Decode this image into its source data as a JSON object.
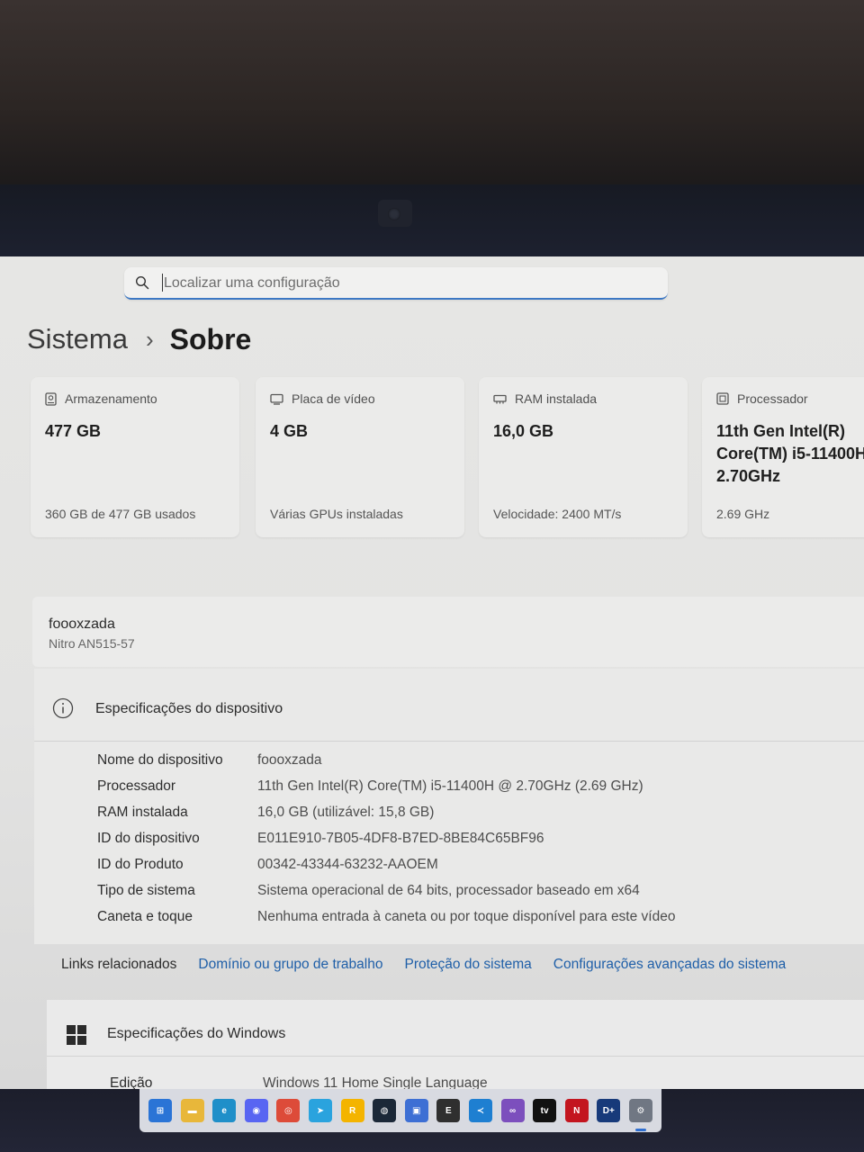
{
  "search": {
    "placeholder": "Localizar uma configuração"
  },
  "breadcrumb": {
    "parent": "Sistema",
    "current": "Sobre"
  },
  "cards": [
    {
      "title": "Armazenamento",
      "value": "477 GB",
      "sub": "360 GB de 477 GB usados",
      "icon": "storage-icon"
    },
    {
      "title": "Placa de vídeo",
      "value": "4 GB",
      "sub": "Várias GPUs instaladas",
      "icon": "gpu-icon"
    },
    {
      "title": "RAM instalada",
      "value": "16,0 GB",
      "sub": "Velocidade: 2400 MT/s",
      "icon": "ram-icon"
    },
    {
      "title": "Processador",
      "value_lines": [
        "11th Gen Intel(R)",
        "Core(TM) i5-11400H",
        "2.70GHz"
      ],
      "sub": "2.69 GHz",
      "icon": "processor-icon"
    }
  ],
  "device": {
    "name": "foooxzada",
    "model": "Nitro AN515-57"
  },
  "device_specs": {
    "title": "Especificações do dispositivo",
    "rows": [
      {
        "label": "Nome do dispositivo",
        "value": "foooxzada"
      },
      {
        "label": "Processador",
        "value": "11th Gen Intel(R) Core(TM) i5-11400H @ 2.70GHz (2.69 GHz)"
      },
      {
        "label": "RAM instalada",
        "value": "16,0 GB (utilizável: 15,8 GB)"
      },
      {
        "label": "ID do dispositivo",
        "value": "E011E910-7B05-4DF8-B7ED-8BE84C65BF96"
      },
      {
        "label": "ID do Produto",
        "value": "00342-43344-63232-AAOEM"
      },
      {
        "label": "Tipo de sistema",
        "value": "Sistema operacional de 64 bits, processador baseado em x64"
      },
      {
        "label": "Caneta e toque",
        "value": "Nenhuma entrada à caneta ou por toque disponível para este vídeo"
      }
    ]
  },
  "related_links": {
    "label": "Links relacionados",
    "links": [
      "Domínio ou grupo de trabalho",
      "Proteção do sistema",
      "Configurações avançadas do sistema"
    ]
  },
  "windows_specs": {
    "title": "Especificações do Windows",
    "rows": [
      {
        "label": "Edição",
        "value": "Windows 11 Home Single Language"
      }
    ]
  },
  "taskbar": {
    "items": [
      {
        "icon": "windows-start-icon",
        "color": "#2a74d6"
      },
      {
        "icon": "file-explorer-icon",
        "color": "#e8b73a"
      },
      {
        "icon": "edge-icon",
        "color": "#1f8fc9"
      },
      {
        "icon": "discord-icon",
        "color": "#5865f2"
      },
      {
        "icon": "chrome-icon",
        "color": "#dd4b39"
      },
      {
        "icon": "telegram-icon",
        "color": "#2aa3de"
      },
      {
        "icon": "rockstar-icon",
        "color": "#f4b400"
      },
      {
        "icon": "steam-icon",
        "color": "#1b2838"
      },
      {
        "icon": "store-icon",
        "color": "#3d6fd4"
      },
      {
        "icon": "epic-games-icon",
        "color": "#2f2f2f"
      },
      {
        "icon": "vscode-icon",
        "color": "#1e7fd1"
      },
      {
        "icon": "visual-studio-icon",
        "color": "#7c4fbd"
      },
      {
        "icon": "apple-tv-icon",
        "color": "#111111"
      },
      {
        "icon": "netflix-icon",
        "color": "#c3151f"
      },
      {
        "icon": "disney-plus-icon",
        "color": "#173a7a"
      },
      {
        "icon": "settings-icon",
        "color": "#707783",
        "active": true
      }
    ]
  }
}
